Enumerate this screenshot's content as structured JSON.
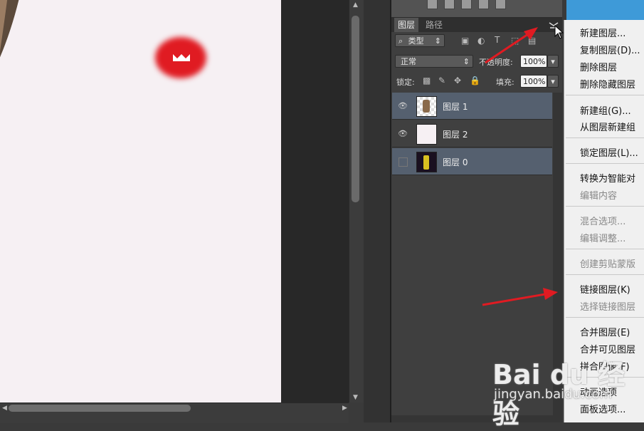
{
  "layers_panel": {
    "tabs": [
      "图层",
      "路径"
    ],
    "filter_type": "类型",
    "blend_mode": "正常",
    "opacity_label": "不透明度:",
    "opacity_value": "100%",
    "lock_label": "锁定:",
    "fill_label": "填充:",
    "fill_value": "100%",
    "layers": [
      {
        "name": "图层 1",
        "visible": true,
        "selected": true
      },
      {
        "name": "图层 2",
        "visible": true,
        "selected": false
      },
      {
        "name": "图层 0",
        "visible": false,
        "selected": true
      }
    ]
  },
  "context_menu": {
    "items": [
      {
        "label": "新建图层...",
        "enabled": true
      },
      {
        "label": "复制图层(D)...",
        "enabled": true
      },
      {
        "label": "删除图层",
        "enabled": true
      },
      {
        "label": "删除隐藏图层",
        "enabled": true
      },
      {
        "label": "新建组(G)...",
        "enabled": true
      },
      {
        "label": "从图层新建组",
        "enabled": true
      },
      {
        "label": "锁定图层(L)...",
        "enabled": true
      },
      {
        "label": "转换为智能对",
        "enabled": true
      },
      {
        "label": "编辑内容",
        "enabled": false
      },
      {
        "label": "混合选项...",
        "enabled": false
      },
      {
        "label": "编辑调整...",
        "enabled": false
      },
      {
        "label": "创建剪贴蒙版",
        "enabled": false
      },
      {
        "label": "链接图层(K)",
        "enabled": true
      },
      {
        "label": "选择链接图层",
        "enabled": false
      },
      {
        "label": "合并图层(E)",
        "enabled": true
      },
      {
        "label": "合并可见图层",
        "enabled": true
      },
      {
        "label": "拼合图像(F)",
        "enabled": true
      },
      {
        "label": "动画选项",
        "enabled": true
      },
      {
        "label": "面板选项...",
        "enabled": true
      }
    ]
  },
  "watermark": {
    "logo": "Bai du 经验",
    "url": "jingyan.baidu.com"
  },
  "colors": {
    "accent_arrow": "#e01b22",
    "selected_layer": "#55606f",
    "canvas_bg": "#f6f0f3"
  }
}
